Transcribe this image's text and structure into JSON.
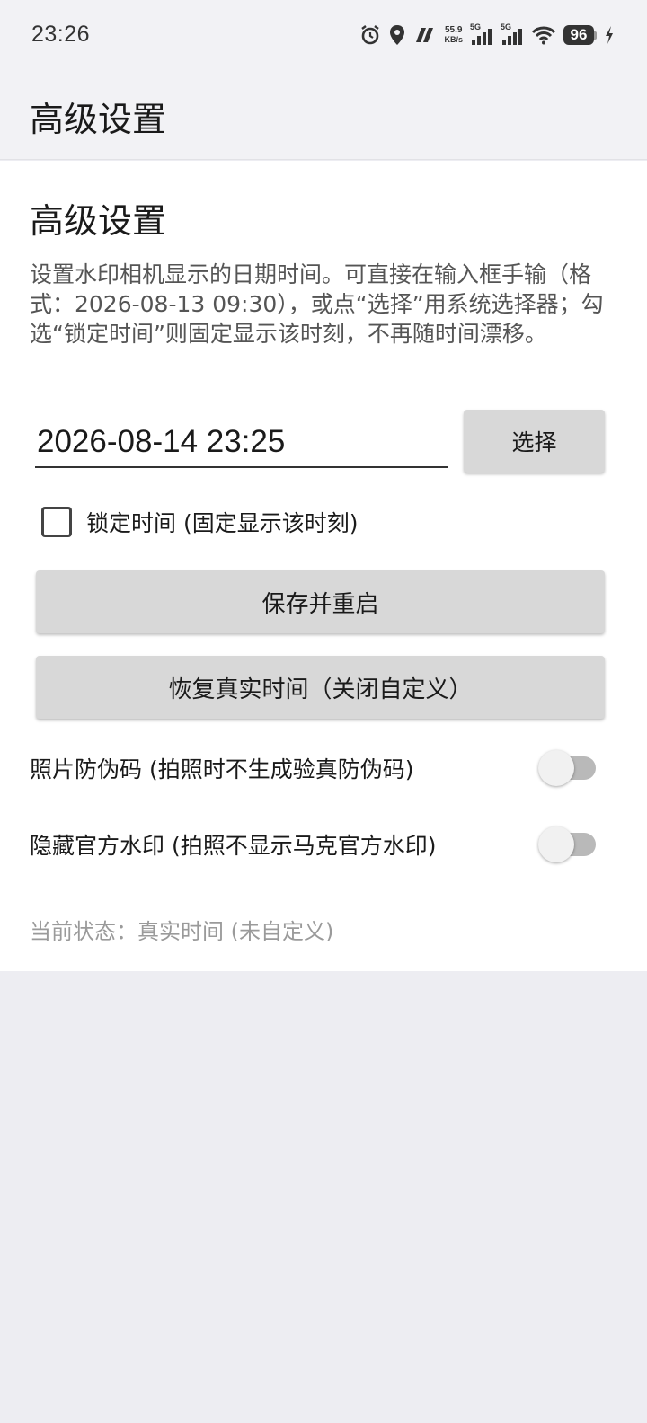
{
  "status_bar": {
    "time": "23:26",
    "net_speed_value": "55.9",
    "net_speed_unit": "KB/s",
    "sim1_label": "5G",
    "sim2_label": "5G",
    "battery": "96",
    "icons": [
      "alarm-icon",
      "location-icon",
      "app-icon",
      "signal-icon",
      "signal-icon",
      "wifi-icon",
      "battery-icon",
      "charging-icon"
    ]
  },
  "app_bar": {
    "title": "高级设置"
  },
  "main": {
    "section_title": "高级设置",
    "description": "设置水印相机显示的日期时间。可直接在输入框手输（格式：2026-08-13 09:30），或点“选择”用系统选择器；勾选“锁定时间”则固定显示该时刻，不再随时间漂移。",
    "datetime_value": "2026-08-14 23:25",
    "pick_label": "选择",
    "lock_label": "锁定时间 (固定显示该时刻)",
    "lock_checked": false,
    "save_label": "保存并重启",
    "restore_label": "恢复真实时间（关闭自定义）",
    "anti_fake_label": "照片防伪码 (拍照时不生成验真防伪码)",
    "anti_fake_on": false,
    "hide_watermark_label": "隐藏官方水印 (拍照不显示马克官方水印)",
    "hide_watermark_on": false,
    "status_text": "当前状态：真实时间 (未自定义)"
  },
  "colors": {
    "app_bar_bg": "#f2f2f5",
    "content_bg": "#ffffff",
    "button_bg": "#d8d8d8",
    "switch_off_track": "#b9b9b9",
    "page_bg": "#ededf2"
  }
}
